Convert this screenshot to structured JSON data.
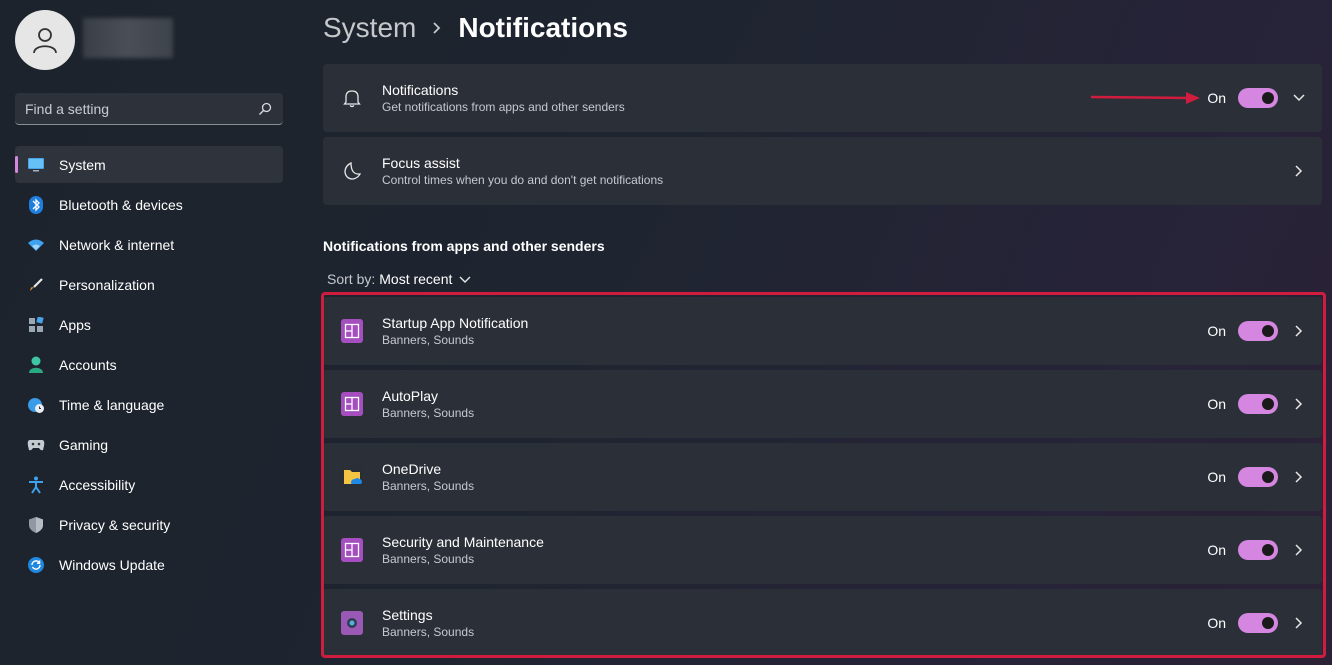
{
  "sidebar": {
    "search": {
      "placeholder": "Find a setting"
    },
    "items": [
      {
        "label": "System",
        "icon": "monitor-icon",
        "active": true
      },
      {
        "label": "Bluetooth & devices",
        "icon": "bluetooth-icon"
      },
      {
        "label": "Network & internet",
        "icon": "wifi-icon"
      },
      {
        "label": "Personalization",
        "icon": "paintbrush-icon"
      },
      {
        "label": "Apps",
        "icon": "apps-icon"
      },
      {
        "label": "Accounts",
        "icon": "person-icon"
      },
      {
        "label": "Time & language",
        "icon": "globe-clock-icon"
      },
      {
        "label": "Gaming",
        "icon": "gamepad-icon"
      },
      {
        "label": "Accessibility",
        "icon": "accessibility-icon"
      },
      {
        "label": "Privacy & security",
        "icon": "shield-icon"
      },
      {
        "label": "Windows Update",
        "icon": "refresh-icon"
      }
    ]
  },
  "header": {
    "parent": "System",
    "current": "Notifications"
  },
  "top_cards": [
    {
      "title": "Notifications",
      "subtitle": "Get notifications from apps and other senders",
      "state": "On",
      "icon": "bell-icon"
    },
    {
      "title": "Focus assist",
      "subtitle": "Control times when you do and don't get notifications",
      "icon": "moon-icon"
    }
  ],
  "apps_section": {
    "title": "Notifications from apps and other senders",
    "sort_label": "Sort by:",
    "sort_value": "Most recent",
    "apps": [
      {
        "name": "Startup App Notification",
        "detail": "Banners, Sounds",
        "state": "On",
        "icon": "generic-app-icon"
      },
      {
        "name": "AutoPlay",
        "detail": "Banners, Sounds",
        "state": "On",
        "icon": "generic-app-icon"
      },
      {
        "name": "OneDrive",
        "detail": "Banners, Sounds",
        "state": "On",
        "icon": "onedrive-folder-icon"
      },
      {
        "name": "Security and Maintenance",
        "detail": "Banners, Sounds",
        "state": "On",
        "icon": "generic-app-icon"
      },
      {
        "name": "Settings",
        "detail": "Banners, Sounds",
        "state": "On",
        "icon": "settings-gear-icon"
      }
    ]
  },
  "colors": {
    "accent": "#d486e0",
    "highlight": "#d01c3f",
    "card": "#2b3038"
  }
}
